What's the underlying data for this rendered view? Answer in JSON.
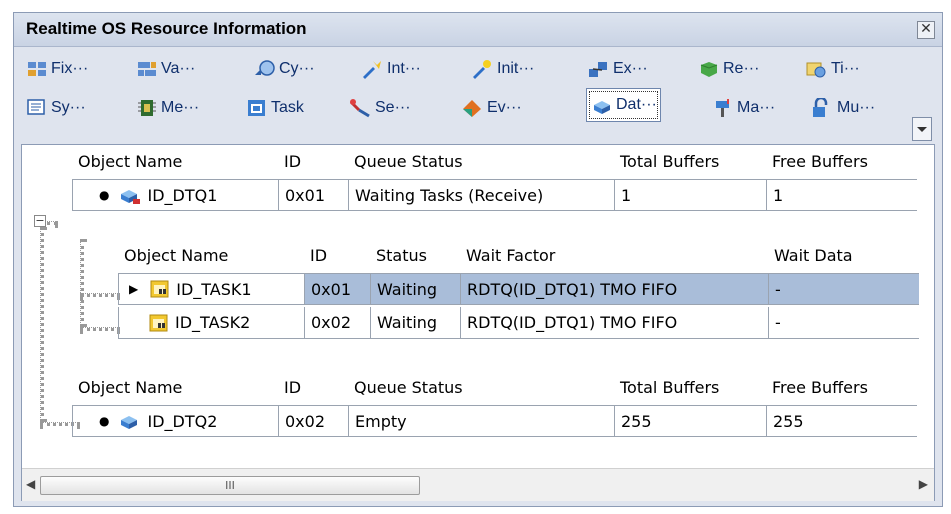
{
  "window": {
    "title": "Realtime OS Resource Information",
    "close_symbol": "✕"
  },
  "toolbar": {
    "row1": [
      {
        "label": "Fix···",
        "icon": "fixed-memory-pool-icon"
      },
      {
        "label": "Va···",
        "icon": "variable-memory-pool-icon"
      },
      {
        "label": "Cy···",
        "icon": "cyclic-handler-icon"
      },
      {
        "label": "Int···",
        "icon": "interrupt-handler-icon"
      },
      {
        "label": "Init···",
        "icon": "initialization-routine-icon"
      },
      {
        "label": "Ex···",
        "icon": "exception-handler-icon"
      },
      {
        "label": "Re···",
        "icon": "rendezvous-icon"
      },
      {
        "label": "Ti···",
        "icon": "timer-icon"
      }
    ],
    "row2": [
      {
        "label": "Sy···",
        "icon": "system-status-icon"
      },
      {
        "label": "Me···",
        "icon": "memory-icon"
      },
      {
        "label": "Task",
        "icon": "task-icon"
      },
      {
        "label": "Se···",
        "icon": "semaphore-icon"
      },
      {
        "label": "Ev···",
        "icon": "eventflag-icon"
      },
      {
        "label": "Dat···",
        "icon": "data-queue-icon",
        "active": true
      },
      {
        "label": "Ma···",
        "icon": "mailbox-icon"
      },
      {
        "label": "Mu···",
        "icon": "mutex-icon"
      }
    ]
  },
  "queue_columns": {
    "object_name": "Object Name",
    "id": "ID",
    "queue_status": "Queue Status",
    "total_buffers": "Total Buffers",
    "free_buffers": "Free Buffers"
  },
  "task_columns": {
    "object_name": "Object Name",
    "id": "ID",
    "status": "Status",
    "wait_factor": "Wait Factor",
    "wait_data": "Wait Data"
  },
  "queues": [
    {
      "name": "ID_DTQ1",
      "id": "0x01",
      "queue_status": "Waiting Tasks (Receive)",
      "total_buffers": "1",
      "free_buffers": "1"
    },
    {
      "name": "ID_DTQ2",
      "id": "0x02",
      "queue_status": "Empty",
      "total_buffers": "255",
      "free_buffers": "255"
    }
  ],
  "tasks": [
    {
      "name": "ID_TASK1",
      "id": "0x01",
      "status": "Waiting",
      "wait_factor": "RDTQ(ID_DTQ1) TMO FIFO",
      "wait_data": "-"
    },
    {
      "name": "ID_TASK2",
      "id": "0x02",
      "status": "Waiting",
      "wait_factor": "RDTQ(ID_DTQ1) TMO FIFO",
      "wait_data": "-"
    }
  ],
  "tree": {
    "expander_symbol": "−"
  },
  "scrollbar": {
    "left_arrow": "◀",
    "right_arrow": "▶",
    "thumb_grip": "III"
  },
  "colors": {
    "selection": "#a9bdd9",
    "title_bg": "#c9d3e4",
    "toolbar_text": "#0f2f6c"
  }
}
